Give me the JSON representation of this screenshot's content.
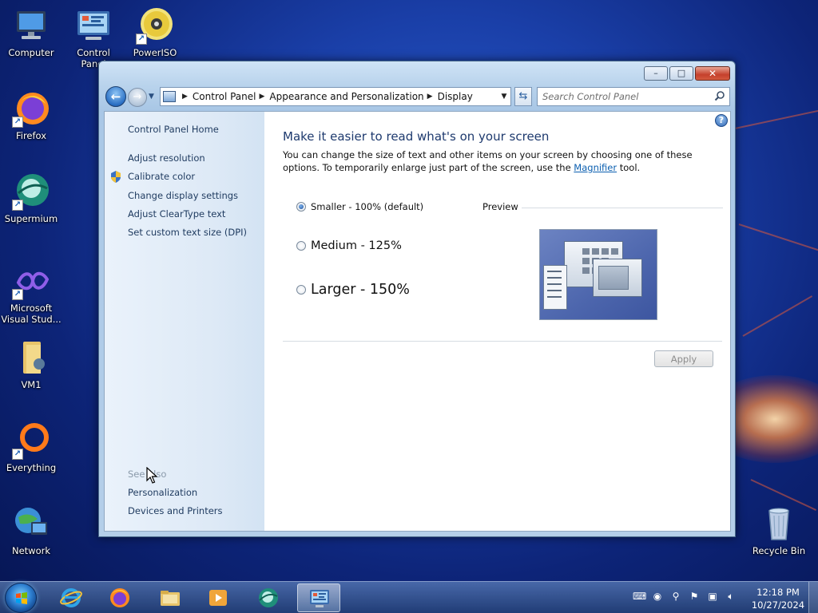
{
  "desktop": {
    "icons": [
      {
        "label": "Computer"
      },
      {
        "label": "Control Panel"
      },
      {
        "label": "PowerISO"
      },
      {
        "label": "Firefox"
      },
      {
        "label": "Supermium"
      },
      {
        "label": "Microsoft Visual Stud..."
      },
      {
        "label": "VM1"
      },
      {
        "label": "Everything"
      },
      {
        "label": "Network"
      },
      {
        "label": "Recycle Bin"
      }
    ]
  },
  "window": {
    "caption": {
      "minimize": "–",
      "maximize": "□",
      "close": "✕"
    },
    "address": {
      "breadcrumbs": [
        "Control Panel",
        "Appearance and Personalization",
        "Display"
      ]
    },
    "search": {
      "placeholder": "Search Control Panel"
    },
    "sidebar": {
      "home": "Control Panel Home",
      "tasks": [
        "Adjust resolution",
        "Calibrate color",
        "Change display settings",
        "Adjust ClearType text",
        "Set custom text size (DPI)"
      ],
      "see_also_label": "See also",
      "see_also": [
        "Personalization",
        "Devices and Printers"
      ]
    },
    "main": {
      "heading": "Make it easier to read what's on your screen",
      "intro_before": "You can change the size of text and other items on your screen by choosing one of these options. To temporarily enlarge just part of the screen, use the ",
      "intro_link": "Magnifier",
      "intro_after": " tool.",
      "options": [
        {
          "label": "Smaller - 100% (default)",
          "selected": true
        },
        {
          "label": "Medium - 125%",
          "selected": false
        },
        {
          "label": "Larger - 150%",
          "selected": false
        }
      ],
      "preview_label": "Preview",
      "apply_label": "Apply",
      "apply_enabled": false
    }
  },
  "taskbar": {
    "pinned": [
      "internet-explorer",
      "firefox",
      "file-explorer",
      "media-player",
      "supermium",
      "control-panel"
    ],
    "clock_time": "12:18 PM",
    "clock_date": "10/27/2024"
  },
  "colors": {
    "link": "#1e3a5f",
    "heading": "#1e3a6e",
    "magnifier_link": "#0b5fb0"
  }
}
